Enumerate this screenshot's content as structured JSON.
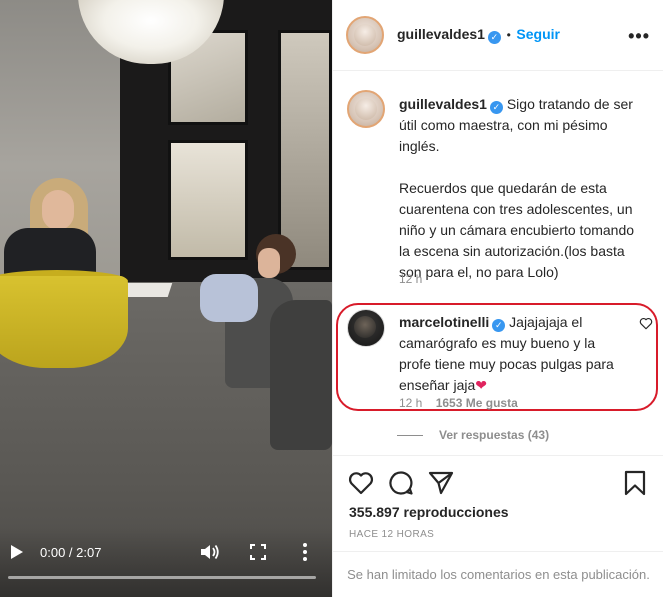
{
  "video": {
    "time": "0:00 / 2:07",
    "progress": 0.0
  },
  "post": {
    "username": "guillevaldes1",
    "follow_label": "Seguir",
    "more_label": "•••",
    "caption": "Sigo tratando de ser útil como maestra, con mi pésimo inglés.\n\nRecuerdos que quedarán de esta cuarentena con tres adolescentes, un niño y un cámara encubierto tomando la escena sin autorización.(los basta son para el, no para Lolo)",
    "caption_time": "12 h"
  },
  "comment": {
    "username": "marcelotinelli",
    "text": "Jajajajaja el camarógrafo es muy bueno y la profe tiene muy pocas pulgas para enseñar jaja",
    "time": "12 h",
    "likes": "1653 Me gusta",
    "replies_label": "Ver respuestas (43)"
  },
  "stats": {
    "views": "355.897 reproducciones",
    "ago": "HACE 12 HORAS"
  },
  "footer": {
    "limited": "Se han limitado los comentarios en esta publicación."
  },
  "colors": {
    "accent": "#0095f6",
    "verified": "#3897f0",
    "highlight_ring": "#d81b2a",
    "heart_emoji": "#e0245e"
  },
  "icons": [
    "play-icon",
    "volume-icon",
    "fullscreen-icon",
    "video-menu-icon",
    "verified-icon",
    "more-icon",
    "heart-icon",
    "comment-icon",
    "share-icon",
    "save-icon",
    "like-comment-icon"
  ]
}
